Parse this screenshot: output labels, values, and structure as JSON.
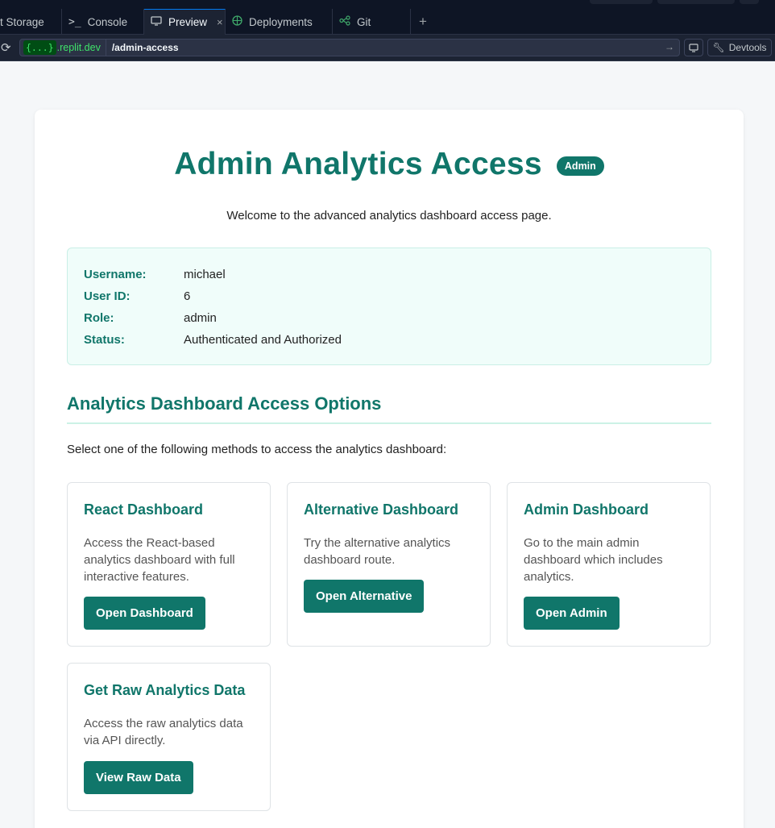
{
  "ide": {
    "tabs": [
      {
        "label": "t Storage",
        "icon": "storage-icon"
      },
      {
        "label": "Console",
        "icon": "terminal-icon"
      },
      {
        "label": "Preview",
        "icon": "monitor-icon",
        "close": "×"
      },
      {
        "label": "Deployments",
        "icon": "globe-icon"
      },
      {
        "label": "Git",
        "icon": "git-icon"
      }
    ],
    "add_tab": "+",
    "reload_icon": "⟳",
    "domain_badge": "{...}",
    "domain": ".replit.dev",
    "path": "/admin-access",
    "devtools_label": "Devtools"
  },
  "page": {
    "title": "Admin Analytics Access",
    "badge": "Admin",
    "welcome": "Welcome to the advanced analytics dashboard access page.",
    "user_info": [
      {
        "label": "Username:",
        "value": "michael"
      },
      {
        "label": "User ID:",
        "value": "6"
      },
      {
        "label": "Role:",
        "value": "admin"
      },
      {
        "label": "Status:",
        "value": "Authenticated and Authorized"
      }
    ],
    "section_title": "Analytics Dashboard Access Options",
    "intro": "Select one of the following methods to access the analytics dashboard:",
    "options": [
      {
        "title": "React Dashboard",
        "description": "Access the React-based analytics dashboard with full interactive features.",
        "button": "Open Dashboard"
      },
      {
        "title": "Alternative Dashboard",
        "description": "Try the alternative analytics dashboard route.",
        "button": "Open Alternative"
      },
      {
        "title": "Admin Dashboard",
        "description": "Go to the main admin dashboard which includes analytics.",
        "button": "Open Admin"
      },
      {
        "title": "Get Raw Analytics Data",
        "description": "Access the raw analytics data via API directly.",
        "button": "View Raw Data"
      }
    ]
  },
  "colors": {
    "brand": "#10766a",
    "info_bg": "#f0fdfa",
    "ide_bg": "#0e1525"
  }
}
